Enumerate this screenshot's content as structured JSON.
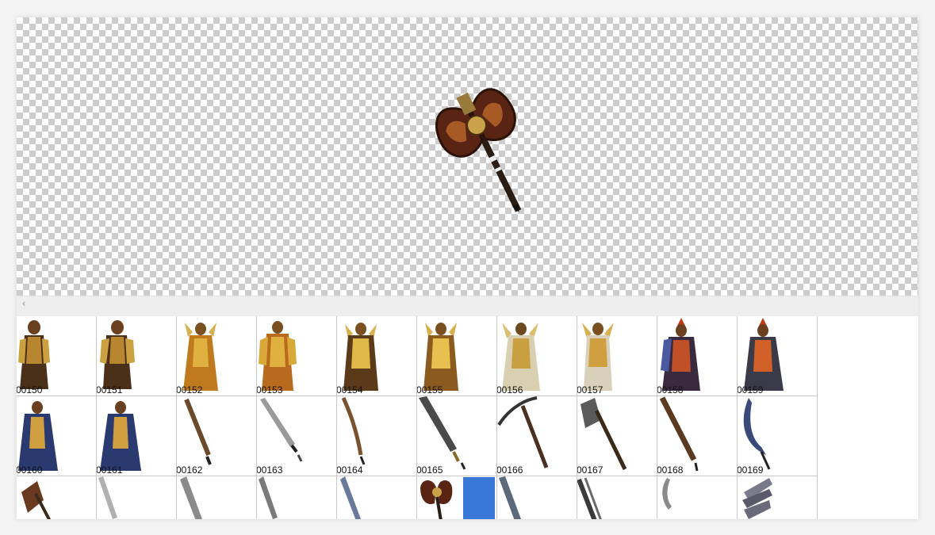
{
  "scrollbar": {
    "left_arrow": "‹"
  },
  "frames": {
    "row1": [
      "00150",
      "00151",
      "00152",
      "00153",
      "00154",
      "00155",
      "00156",
      "00157",
      "00158",
      "00159"
    ],
    "row2": [
      "00160",
      "00161",
      "00162",
      "00163",
      "00164",
      "00165",
      "00166",
      "00167",
      "00168",
      "00169"
    ],
    "row3": [
      "",
      "",
      "",
      "",
      "",
      "",
      "",
      "",
      "",
      ""
    ]
  },
  "preview": {
    "sprite": "double-axe"
  },
  "colors": {
    "selection": "#3a78d8",
    "grid_line": "#c8c8c8",
    "checker": "#cccccc"
  }
}
